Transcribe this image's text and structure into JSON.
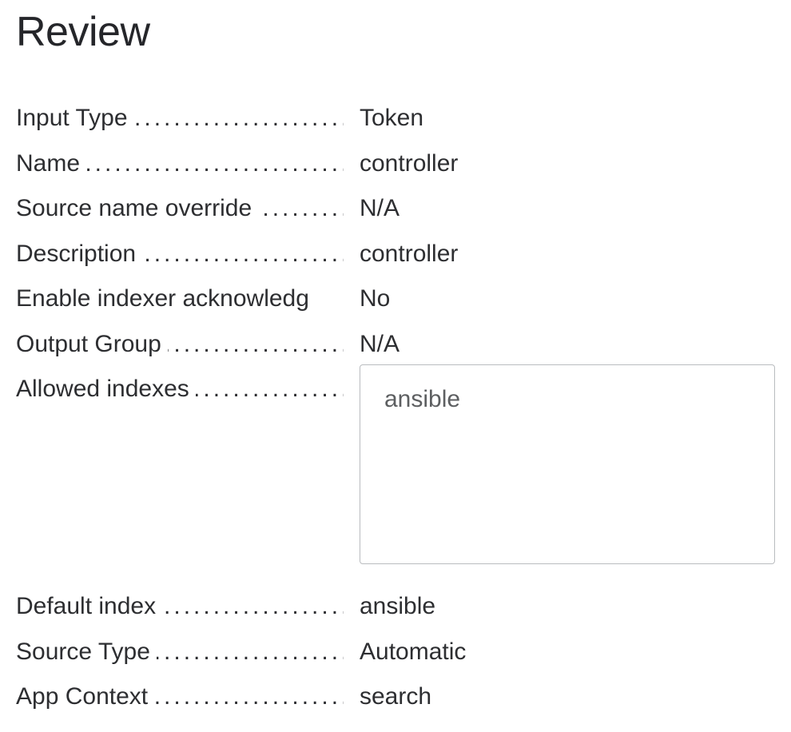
{
  "title": "Review",
  "rows": {
    "input_type": {
      "label": "Input Type",
      "value": "Token",
      "dots": true
    },
    "name": {
      "label": "Name",
      "value": "controller",
      "dots": true
    },
    "source_name": {
      "label": "Source name override",
      "value": "N/A",
      "dots": true
    },
    "description": {
      "label": "Description",
      "value": "controller",
      "dots": true
    },
    "enable_ack": {
      "label": "Enable indexer acknowledg",
      "value": "No",
      "dots": false
    },
    "output_group": {
      "label": "Output Group",
      "value": "N/A",
      "dots": true
    },
    "allowed_idx": {
      "label": "Allowed indexes",
      "value": "ansible",
      "dots": true
    },
    "default_idx": {
      "label": "Default index",
      "value": "ansible",
      "dots": true
    },
    "source_type": {
      "label": "Source Type",
      "value": "Automatic",
      "dots": true
    },
    "app_context": {
      "label": "App Context",
      "value": "search",
      "dots": true
    }
  }
}
